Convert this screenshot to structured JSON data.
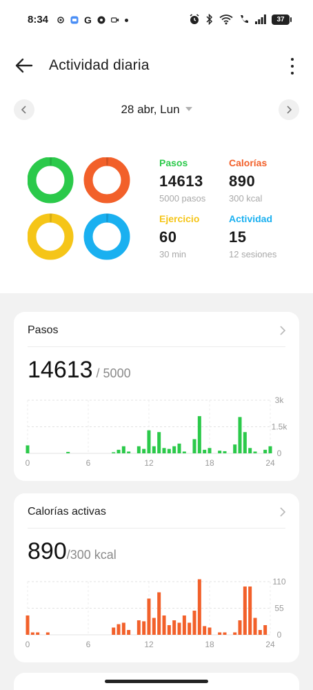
{
  "status_bar": {
    "time": "8:34",
    "battery": "37"
  },
  "app_bar": {
    "title": "Actividad diaria"
  },
  "date_nav": {
    "date": "28 abr, Lun"
  },
  "summary": {
    "steps": {
      "label": "Pasos",
      "value": "14613",
      "goal": "5000 pasos",
      "color": "#2bc94a",
      "progress": 2.92
    },
    "calories": {
      "label": "Calorías",
      "value": "890",
      "goal": "300 kcal",
      "color": "#f2602a",
      "progress": 2.97
    },
    "exercise": {
      "label": "Ejercicio",
      "value": "60",
      "goal": "30 min",
      "color": "#f5c518",
      "progress": 2.0
    },
    "activity": {
      "label": "Actividad",
      "value": "15",
      "goal": "12 sesiones",
      "color": "#1ab0f0",
      "progress": 1.25
    }
  },
  "steps_card": {
    "title": "Pasos",
    "value": "14613",
    "goal": " / 5000",
    "chart_data": {
      "type": "bar",
      "color": "#2bc94a",
      "x": [
        0,
        4,
        8.5,
        9,
        9.5,
        10,
        11,
        11.5,
        12,
        12.5,
        13,
        13.5,
        14,
        14.5,
        15,
        15.5,
        16.5,
        17,
        17.5,
        18,
        19,
        19.5,
        20.5,
        21,
        21.5,
        22,
        22.5,
        23.5,
        24
      ],
      "values": [
        450,
        80,
        60,
        200,
        400,
        100,
        400,
        250,
        1300,
        400,
        1200,
        300,
        250,
        400,
        550,
        100,
        800,
        2100,
        200,
        300,
        150,
        120,
        500,
        2050,
        1200,
        300,
        100,
        200,
        400
      ],
      "xlim": [
        0,
        24
      ],
      "ylim": [
        0,
        3000
      ],
      "x_ticks": [
        "0",
        "6",
        "12",
        "18",
        "24"
      ],
      "y_ticks": [
        "3k",
        "1.5k",
        "0"
      ]
    }
  },
  "calories_card": {
    "title": "Calorías activas",
    "value": "890",
    "goal": "/300 kcal",
    "chart_data": {
      "type": "bar",
      "color": "#f2602a",
      "x": [
        0,
        0.5,
        1,
        2,
        8.5,
        9,
        9.5,
        10,
        11,
        11.5,
        12,
        12.5,
        13,
        13.5,
        14,
        14.5,
        15,
        15.5,
        16,
        16.5,
        17,
        17.5,
        18,
        19,
        19.5,
        20.5,
        21,
        21.5,
        22,
        22.5,
        23,
        23.5
      ],
      "values": [
        40,
        5,
        5,
        5,
        15,
        22,
        25,
        10,
        30,
        28,
        75,
        35,
        88,
        40,
        20,
        30,
        25,
        40,
        25,
        50,
        115,
        18,
        15,
        5,
        5,
        5,
        30,
        100,
        100,
        35,
        10,
        20
      ],
      "xlim": [
        0,
        24
      ],
      "ylim": [
        0,
        110
      ],
      "x_ticks": [
        "0",
        "6",
        "12",
        "18",
        "24"
      ],
      "y_ticks": [
        "110",
        "55",
        "0"
      ]
    }
  }
}
